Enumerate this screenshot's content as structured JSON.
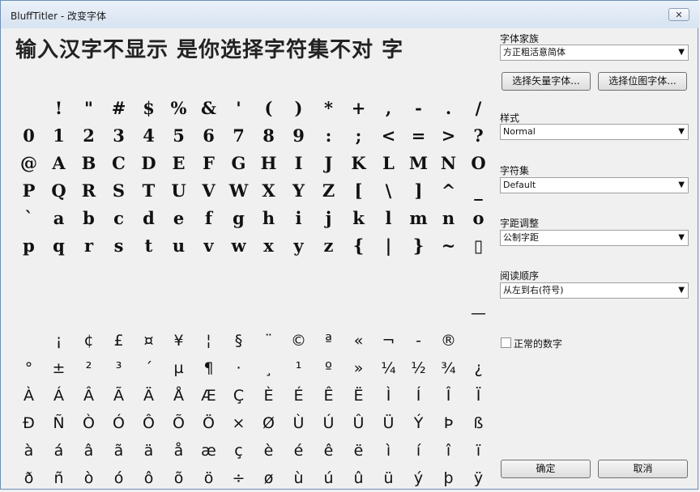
{
  "window": {
    "title": "BluffTitler - 改变字体",
    "close_symbol": "✕"
  },
  "preview": {
    "text": "输入汉字不显示 是你选择字符集不对 字"
  },
  "glyph_grid_top": [
    [
      "",
      "!",
      "\"",
      "#",
      "$",
      "%",
      "&",
      "'",
      "(",
      ")",
      "*",
      "+",
      ",",
      "-",
      ".",
      "/"
    ],
    [
      "0",
      "1",
      "2",
      "3",
      "4",
      "5",
      "6",
      "7",
      "8",
      "9",
      ":",
      ";",
      "<",
      "=",
      ">",
      "?"
    ],
    [
      "@",
      "A",
      "B",
      "C",
      "D",
      "E",
      "F",
      "G",
      "H",
      "I",
      "J",
      "K",
      "L",
      "M",
      "N",
      "O"
    ],
    [
      "P",
      "Q",
      "R",
      "S",
      "T",
      "U",
      "V",
      "W",
      "X",
      "Y",
      "Z",
      "[",
      "\\",
      "]",
      "^",
      "_"
    ],
    [
      "`",
      "a",
      "b",
      "c",
      "d",
      "e",
      "f",
      "g",
      "h",
      "i",
      "j",
      "k",
      "l",
      "m",
      "n",
      "o"
    ],
    [
      "p",
      "q",
      "r",
      "s",
      "t",
      "u",
      "v",
      "w",
      "x",
      "y",
      "z",
      "{",
      "|",
      "}",
      "~",
      "▯"
    ]
  ],
  "glyph_grid_bottom": [
    [
      "",
      "",
      "",
      "",
      "",
      "",
      "",
      "",
      "",
      "",
      "",
      "",
      "",
      "",
      "",
      "—"
    ],
    [
      "",
      "¡",
      "¢",
      "£",
      "¤",
      "¥",
      "¦",
      "§",
      "¨",
      "©",
      "ª",
      "«",
      "¬",
      "-",
      "®",
      ""
    ],
    [
      "°",
      "±",
      "²",
      "³",
      "´",
      "µ",
      "¶",
      "·",
      "¸",
      "¹",
      "º",
      "»",
      "¼",
      "½",
      "¾",
      "¿"
    ],
    [
      "À",
      "Á",
      "Â",
      "Ã",
      "Ä",
      "Å",
      "Æ",
      "Ç",
      "È",
      "É",
      "Ê",
      "Ë",
      "Ì",
      "Í",
      "Î",
      "Ï"
    ],
    [
      "Ð",
      "Ñ",
      "Ò",
      "Ó",
      "Ô",
      "Õ",
      "Ö",
      "×",
      "Ø",
      "Ù",
      "Ú",
      "Û",
      "Ü",
      "Ý",
      "Þ",
      "ß"
    ],
    [
      "à",
      "á",
      "â",
      "ã",
      "ä",
      "å",
      "æ",
      "ç",
      "è",
      "é",
      "ê",
      "ë",
      "ì",
      "í",
      "î",
      "ï"
    ],
    [
      "ð",
      "ñ",
      "ò",
      "ó",
      "ô",
      "õ",
      "ö",
      "÷",
      "ø",
      "ù",
      "ú",
      "û",
      "ü",
      "ý",
      "þ",
      "ÿ"
    ]
  ],
  "font_family": {
    "label": "字体家族",
    "value": "方正粗活意简体"
  },
  "buttons": {
    "vector_font": "选择矢量字体...",
    "bitmap_font": "选择位图字体...",
    "ok": "确定",
    "cancel": "取消"
  },
  "style": {
    "label": "样式",
    "value": "Normal"
  },
  "charset": {
    "label": "字符集",
    "value": "Default"
  },
  "spacing": {
    "label": "字距调整",
    "value": "公制字距"
  },
  "reading_order": {
    "label": "阅读顺序",
    "value": "从左到右(符号)"
  },
  "normal_digits": {
    "label": "正常的数字",
    "checked": false
  },
  "dropdown_arrow": "▼"
}
